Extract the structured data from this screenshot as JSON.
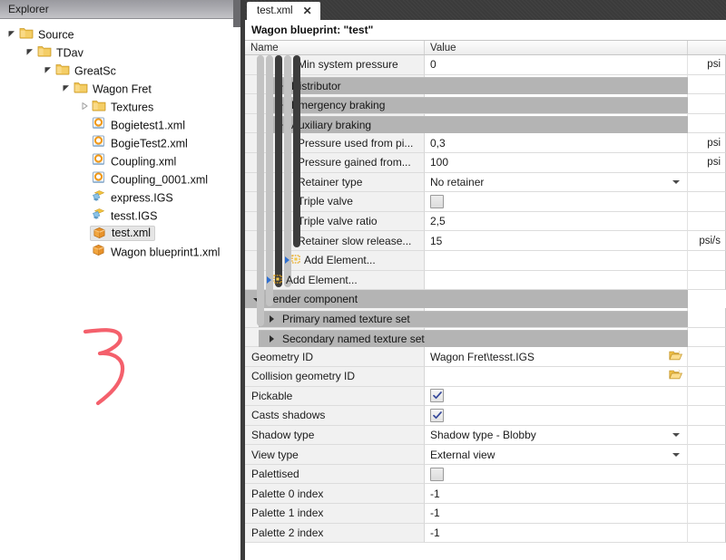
{
  "explorer": {
    "header": "Explorer",
    "tree": [
      {
        "label": "Source",
        "depth": 0,
        "type": "folder",
        "state": "expanded",
        "selected": false
      },
      {
        "label": "TDav",
        "depth": 1,
        "type": "folder",
        "state": "expanded",
        "selected": false
      },
      {
        "label": "GreatSc",
        "depth": 2,
        "type": "folder",
        "state": "expanded",
        "selected": false
      },
      {
        "label": "Wagon Fret",
        "depth": 3,
        "type": "folder",
        "state": "expanded",
        "selected": false
      },
      {
        "label": "Textures",
        "depth": 4,
        "type": "folder",
        "state": "collapsed",
        "selected": false
      },
      {
        "label": "Bogietest1.xml",
        "depth": 4,
        "type": "xml-ring",
        "state": "leaf",
        "selected": false
      },
      {
        "label": "BogieTest2.xml",
        "depth": 4,
        "type": "xml-ring",
        "state": "leaf",
        "selected": false
      },
      {
        "label": "Coupling.xml",
        "depth": 4,
        "type": "xml-ring",
        "state": "leaf",
        "selected": false
      },
      {
        "label": "Coupling_0001.xml",
        "depth": 4,
        "type": "xml-ring",
        "state": "leaf",
        "selected": false
      },
      {
        "label": "express.IGS",
        "depth": 4,
        "type": "igs",
        "state": "leaf",
        "selected": false
      },
      {
        "label": "tesst.IGS",
        "depth": 4,
        "type": "igs",
        "state": "leaf",
        "selected": false
      },
      {
        "label": "test.xml",
        "depth": 4,
        "type": "box",
        "state": "leaf",
        "selected": true
      },
      {
        "label": "Wagon blueprint1.xml",
        "depth": 4,
        "type": "box",
        "state": "leaf",
        "selected": false
      }
    ]
  },
  "editor": {
    "tab": {
      "label": "test.xml",
      "close": "✕"
    },
    "title": "Wagon blueprint: \"test\"",
    "columns": {
      "name": "Name",
      "value": "Value",
      "unit": ""
    },
    "rows": [
      {
        "kind": "prop",
        "name": "Min system pressure",
        "value": "0",
        "unit": "psi",
        "control": "text",
        "indent": 5
      },
      {
        "kind": "section",
        "name": "Distributor",
        "indent": 5
      },
      {
        "kind": "section",
        "name": "Emergency braking",
        "indent": 5
      },
      {
        "kind": "section",
        "name": "Auxiliary braking",
        "indent": 5
      },
      {
        "kind": "prop",
        "name": "Pressure used from pi...",
        "value": "0,3",
        "unit": "psi",
        "control": "text",
        "indent": 5
      },
      {
        "kind": "prop",
        "name": "Pressure gained from...",
        "value": "100",
        "unit": "psi",
        "control": "text",
        "indent": 5
      },
      {
        "kind": "prop",
        "name": "Retainer type",
        "value": "No retainer",
        "unit": "",
        "control": "dropdown",
        "indent": 5
      },
      {
        "kind": "prop",
        "name": "Triple valve",
        "value": "",
        "unit": "",
        "control": "checkbox-off",
        "indent": 5
      },
      {
        "kind": "prop",
        "name": "Triple valve ratio",
        "value": "2,5",
        "unit": "",
        "control": "text",
        "indent": 5
      },
      {
        "kind": "prop",
        "name": "Retainer slow release...",
        "value": "15",
        "unit": "psi/s",
        "control": "text",
        "indent": 5
      },
      {
        "kind": "add",
        "name": "Add Element...",
        "indent": 3
      },
      {
        "kind": "add",
        "name": "Add Element...",
        "indent": 1
      },
      {
        "kind": "top",
        "name": "Render component"
      },
      {
        "kind": "section2",
        "name": "Primary named texture set",
        "indent": 1
      },
      {
        "kind": "section2",
        "name": "Secondary named texture set",
        "indent": 1
      },
      {
        "kind": "prop",
        "name": "Geometry ID",
        "value": "Wagon Fret\\tesst.IGS",
        "unit": "",
        "control": "browse",
        "indent": 0
      },
      {
        "kind": "prop",
        "name": "Collision geometry ID",
        "value": "",
        "unit": "",
        "control": "browse",
        "indent": 0
      },
      {
        "kind": "prop",
        "name": "Pickable",
        "value": "",
        "unit": "",
        "control": "checkbox-on",
        "indent": 0
      },
      {
        "kind": "prop",
        "name": "Casts shadows",
        "value": "",
        "unit": "",
        "control": "checkbox-on",
        "indent": 0
      },
      {
        "kind": "prop",
        "name": "Shadow type",
        "value": "Shadow type - Blobby",
        "unit": "",
        "control": "dropdown",
        "indent": 0
      },
      {
        "kind": "prop",
        "name": "View type",
        "value": "External view",
        "unit": "",
        "control": "dropdown",
        "indent": 0
      },
      {
        "kind": "prop",
        "name": "Palettised",
        "value": "",
        "unit": "",
        "control": "checkbox-off",
        "indent": 0
      },
      {
        "kind": "prop",
        "name": "Palette 0 index",
        "value": "-1",
        "unit": "",
        "control": "text",
        "indent": 0
      },
      {
        "kind": "prop",
        "name": "Palette 1 index",
        "value": "-1",
        "unit": "",
        "control": "text",
        "indent": 0
      },
      {
        "kind": "prop",
        "name": "Palette 2 index",
        "value": "-1",
        "unit": "",
        "control": "text",
        "indent": 0
      }
    ]
  },
  "annotation": {
    "label": "3",
    "color": "#f4606c"
  },
  "colors": {
    "panel_header_top": "#9a9a9f",
    "section_bar": "#b4b4b4",
    "name_cell": "#f1f1f1",
    "tab_strip": "#3b3b3b",
    "guide_dark": "#3c3c3c",
    "guide_light": "#c3c3c3",
    "folder": "#f2c14e",
    "accent_blue": "#2f6fd0"
  }
}
